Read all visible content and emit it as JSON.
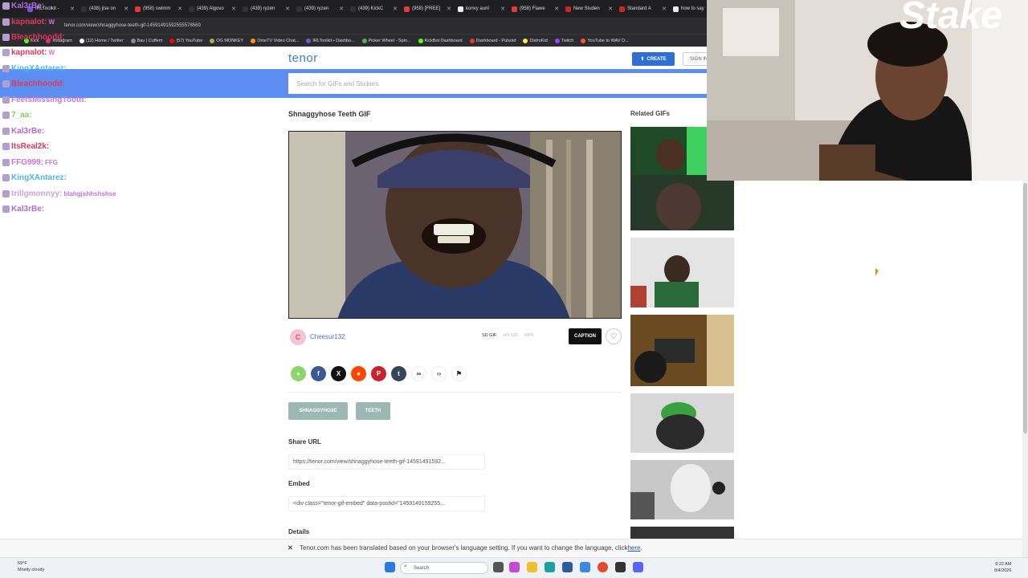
{
  "browser": {
    "tabs": [
      {
        "label": "IRLToolkit -",
        "color": "#6a5acd"
      },
      {
        "label": "(438) jise on",
        "color": "#333333"
      },
      {
        "label": "(958) swimm",
        "color": "#e53935"
      },
      {
        "label": "(439) Algovo",
        "color": "#333333"
      },
      {
        "label": "(439) ryzen",
        "color": "#333333"
      },
      {
        "label": "(439) ryzen",
        "color": "#333333"
      },
      {
        "label": "(439) KickC",
        "color": "#333333"
      },
      {
        "label": "(958) [FREE]",
        "color": "#e53935"
      },
      {
        "label": "konvy aunt",
        "color": "#eeeeee"
      },
      {
        "label": "(958) Flawe",
        "color": "#e53935"
      },
      {
        "label": "New Studen",
        "color": "#c62828"
      },
      {
        "label": "Standard A",
        "color": "#c62828"
      },
      {
        "label": "how to say",
        "color": "#eeeeee"
      }
    ],
    "url": "tenor.com/view/shnaggyhose-teeth-gif-14591491592555578569",
    "bookmarks": [
      {
        "label": "Kick",
        "color": "#53fc18"
      },
      {
        "label": "Instagram",
        "color": "#e1306c"
      },
      {
        "label": "(12) Home / Twitter",
        "color": "#ffffff"
      },
      {
        "label": "Bau | Cuffem",
        "color": "#888888"
      },
      {
        "label": "(57) YouTube",
        "color": "#ff0000"
      },
      {
        "label": "OG MONKEY",
        "color": "#aaaa55"
      },
      {
        "label": "OmeTV Video Chat...",
        "color": "#ff9800"
      },
      {
        "label": "IRLToolkit • Dashbo...",
        "color": "#6a5acd"
      },
      {
        "label": "Picker Wheel - Spin...",
        "color": "#4caf50"
      },
      {
        "label": "KickBot Dashboard",
        "color": "#53fc18"
      },
      {
        "label": "Dashboard - Pulsoid",
        "color": "#e53935"
      },
      {
        "label": "DistroKid",
        "color": "#ffeb3b"
      },
      {
        "label": "Twitch",
        "color": "#9146ff"
      },
      {
        "label": "YouTube to WAV D...",
        "color": "#ff5722"
      }
    ]
  },
  "tenor": {
    "logo": "tenor",
    "create_label": "CREATE",
    "signin_label": "SIGN IN",
    "search_placeholder": "Search for GIFs and Stickers",
    "gif_title": "Shnaggyhose Teeth GIF",
    "related_title": "Related GIFs",
    "author_initial": "C",
    "author": "Cheesur132",
    "formats": [
      "SD GIF",
      "HD GIF",
      "MP4"
    ],
    "caption_label": "CAPTION",
    "tags": [
      "SHNAGGYHOSE",
      "TEETH"
    ],
    "share_url_label": "Share URL",
    "share_url": "https://tenor.com/view/shnaggyhose-teeth-gif-14591491592...",
    "embed_label": "Embed",
    "embed_code": "<div class=\"tenor-gif-embed\" data-postid=\"1459149159255...",
    "details_label": "Details",
    "accent": "#2f6fcf"
  },
  "translate_bar": {
    "text": "Tenor.com has been translated based on your browser's language setting. If you want to change the language, click ",
    "link": "here",
    "end": "."
  },
  "taskbar": {
    "weather_temp": "69°F",
    "weather_desc": "Mostly cloudy",
    "search": "Search",
    "time": "9:22 AM",
    "date": "8/4/2026"
  },
  "chat": [
    {
      "user": "Kal3rBe:",
      "color": "#b26ad6",
      "msg": ""
    },
    {
      "user": "kapnalot:",
      "color": "#e0385a",
      "msg": "W"
    },
    {
      "user": "Bleachhoodd:",
      "color": "#e0385a",
      "msg": ""
    },
    {
      "user": "kapnalot:",
      "color": "#e0385a",
      "msg": "W"
    },
    {
      "user": "KingXAntarez:",
      "color": "#4db8e8",
      "msg": ""
    },
    {
      "user": "Bleachhoodd:",
      "color": "#e0385a",
      "msg": ""
    },
    {
      "user": "FeefsMissingTooth:",
      "color": "#c874d8",
      "msg": ""
    },
    {
      "user": "7_aa:",
      "color": "#7fd65a",
      "msg": ""
    },
    {
      "user": "Kal3rBe:",
      "color": "#b26ad6",
      "msg": ""
    },
    {
      "user": "ItsReal2k:",
      "color": "#e0385a",
      "msg": ""
    },
    {
      "user": "FFG999:",
      "color": "#c874d8",
      "msg": "FFG"
    },
    {
      "user": "KingXAntarez:",
      "color": "#4db8e8",
      "msg": ""
    },
    {
      "user": "trillgmonnyy:",
      "color": "#d0a0e0",
      "msg": "blahgjshhshshse"
    },
    {
      "user": "Kal3rBe:",
      "color": "#b26ad6",
      "msg": ""
    }
  ],
  "stream": {
    "sponsor": "Stake"
  }
}
